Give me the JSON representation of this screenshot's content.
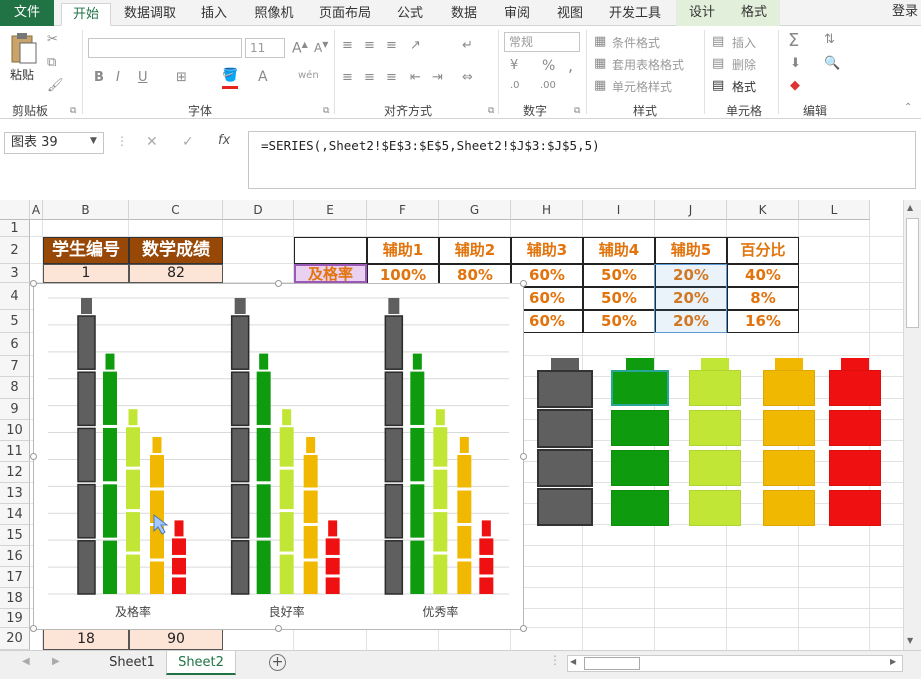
{
  "ribbon_tabs": [
    "文件",
    "开始",
    "数据调取",
    "插入",
    "照像机",
    "页面布局",
    "公式",
    "数据",
    "审阅",
    "视图",
    "开发工具",
    "设计",
    "格式"
  ],
  "login": "登录",
  "clipboard": {
    "paste": "粘贴",
    "label": "剪贴板"
  },
  "font": {
    "name": "",
    "size": "11",
    "label": "字体",
    "bold": "B",
    "italic": "I",
    "underline": "U",
    "wen": "wén"
  },
  "align": {
    "label": "对齐方式"
  },
  "number": {
    "format": "常规",
    "label": "数字",
    "pct": "%",
    "comma": ","
  },
  "styles": {
    "cond": "条件格式",
    "table": "套用表格格式",
    "cell": "单元格样式",
    "label": "样式"
  },
  "cells": {
    "insert": "插入",
    "delete": "删除",
    "format": "格式",
    "label": "单元格"
  },
  "editing": {
    "label": "编辑",
    "sum": "Σ"
  },
  "formula_bar": {
    "name_box": "图表 39",
    "fx": "fx",
    "cancel": "✕",
    "confirm": "✓",
    "formula": "=SERIES(,Sheet2!$E$3:$E$5,Sheet2!$J$3:$J$5,5)"
  },
  "columns": [
    "A",
    "B",
    "C",
    "D",
    "E",
    "F",
    "G",
    "H",
    "I",
    "J",
    "K",
    "L"
  ],
  "rows": [
    "1",
    "2",
    "3",
    "4",
    "5",
    "6",
    "7",
    "8",
    "9",
    "10",
    "11",
    "12",
    "13",
    "14",
    "15",
    "16",
    "17",
    "18",
    "19",
    "20"
  ],
  "table_headers": {
    "b2": "学生编号",
    "c2": "数学成绩"
  },
  "table_rows": {
    "b3": "1",
    "c3": "82",
    "b20": "18",
    "c20": "90"
  },
  "aux_headers": [
    "辅助1",
    "辅助2",
    "辅助3",
    "辅助4",
    "辅助5",
    "百分比"
  ],
  "aux_row_label": "及格率",
  "aux_values": [
    [
      "100%",
      "80%",
      "60%",
      "50%",
      "20%",
      "40%"
    ],
    [
      "",
      "",
      "60%",
      "50%",
      "20%",
      "8%"
    ],
    [
      "",
      "",
      "60%",
      "50%",
      "20%",
      "16%"
    ]
  ],
  "chart_data": {
    "type": "bar",
    "categories": [
      "及格率",
      "良好率",
      "优秀率"
    ],
    "series": [
      {
        "values": [
          1.0,
          1.0,
          1.0
        ],
        "color": "#5f5f5f"
      },
      {
        "values": [
          0.8,
          0.8,
          0.8
        ],
        "color": "#0e9b0e"
      },
      {
        "values": [
          0.6,
          0.6,
          0.6
        ],
        "color": "#c2e635"
      },
      {
        "values": [
          0.5,
          0.5,
          0.5
        ],
        "color": "#f0b800"
      },
      {
        "values": [
          0.2,
          0.2,
          0.2
        ],
        "color": "#ef1111"
      }
    ]
  },
  "legend_batteries": [
    "#5f5f5f",
    "#0e9b0e",
    "#c2e635",
    "#f0b800",
    "#ef1111"
  ],
  "sheets": [
    "Sheet1",
    "Sheet2"
  ],
  "active_sheet": "Sheet2"
}
